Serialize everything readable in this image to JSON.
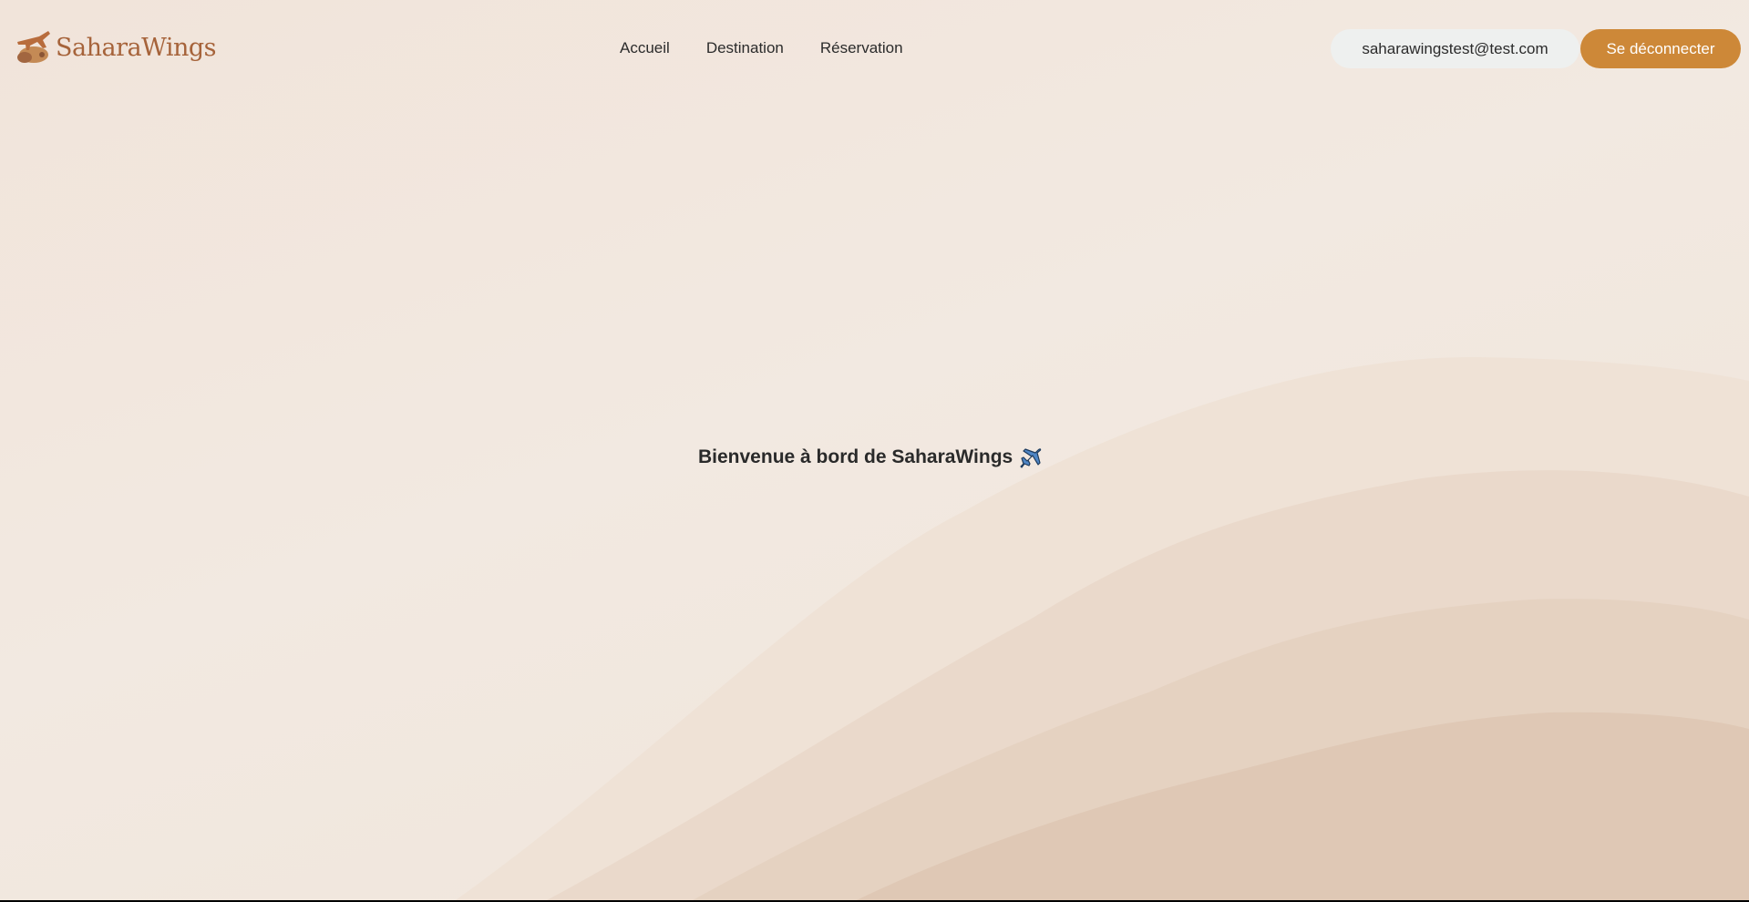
{
  "brand": {
    "name": "SaharaWings",
    "logo_icon": "desert-plane-logo-icon"
  },
  "nav": {
    "items": [
      {
        "label": "Accueil"
      },
      {
        "label": "Destination"
      },
      {
        "label": "Réservation"
      }
    ]
  },
  "account": {
    "email": "saharawingstest@test.com",
    "logout_label": "Se déconnecter"
  },
  "hero": {
    "title": "Bienvenue à bord de SaharaWings",
    "icon": "airplane-icon"
  },
  "colors": {
    "accent": "#cd8838",
    "brand_text": "#a6633a",
    "background": "#f1e6dc",
    "email_pill": "#eef0ef"
  }
}
